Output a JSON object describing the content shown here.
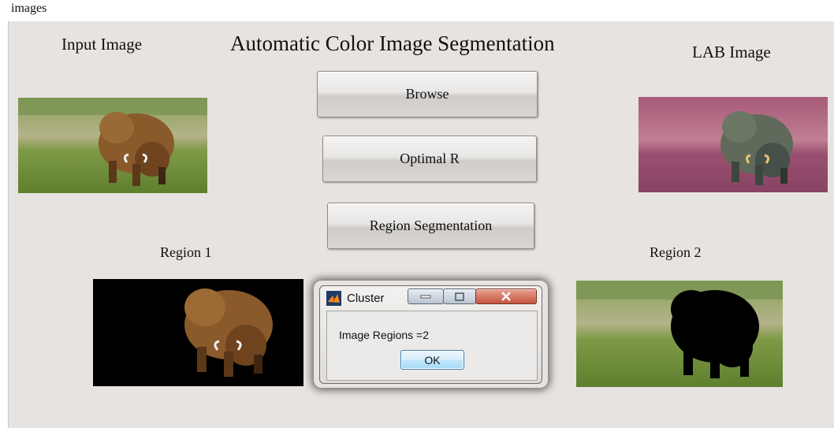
{
  "caption": "images",
  "window": {
    "title": "Automatic Color Image Segmentation",
    "labels": {
      "input_image": "Input Image",
      "lab_image": "LAB Image",
      "region1": "Region 1",
      "region2": "Region 2"
    },
    "buttons": {
      "browse": "Browse",
      "optimal_r": "Optimal R",
      "region_segmentation": "Region Segmentation"
    }
  },
  "dialog": {
    "title": "Cluster",
    "message": "Image Regions  =2",
    "ok_label": "OK",
    "icon": "matlab-icon"
  },
  "colors": {
    "panel_bg": "#e6e3e1",
    "grass": "#6f8a3c",
    "bison": "#8a5a2b",
    "lab_tint": "#a55a7a"
  }
}
